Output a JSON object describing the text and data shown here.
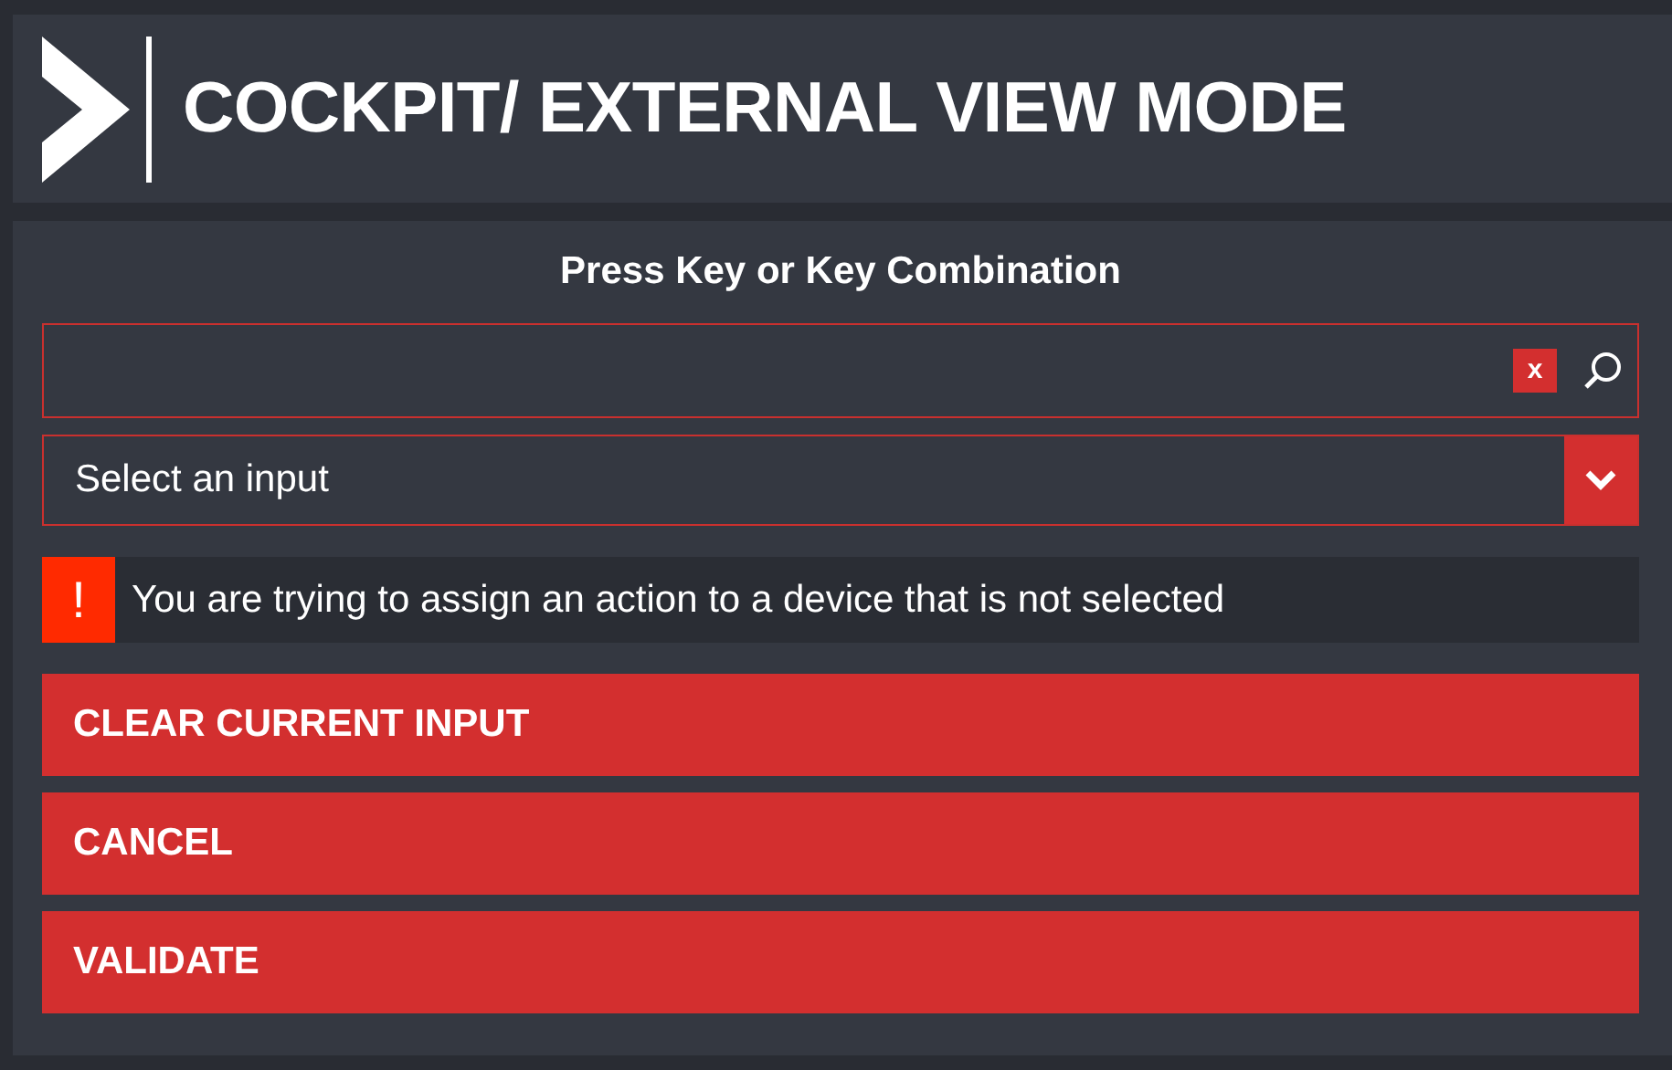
{
  "header": {
    "title": "COCKPIT/ EXTERNAL VIEW MODE"
  },
  "dialog": {
    "prompt": "Press Key or Key Combination",
    "key_field": {
      "clear_label": "x"
    },
    "input_select": {
      "value": "Select an input"
    },
    "warning": {
      "icon": "!",
      "message": "You are trying to assign an action to a device that is not selected"
    },
    "buttons": [
      {
        "label": "CLEAR CURRENT INPUT"
      },
      {
        "label": "CANCEL"
      },
      {
        "label": "VALIDATE"
      }
    ]
  }
}
